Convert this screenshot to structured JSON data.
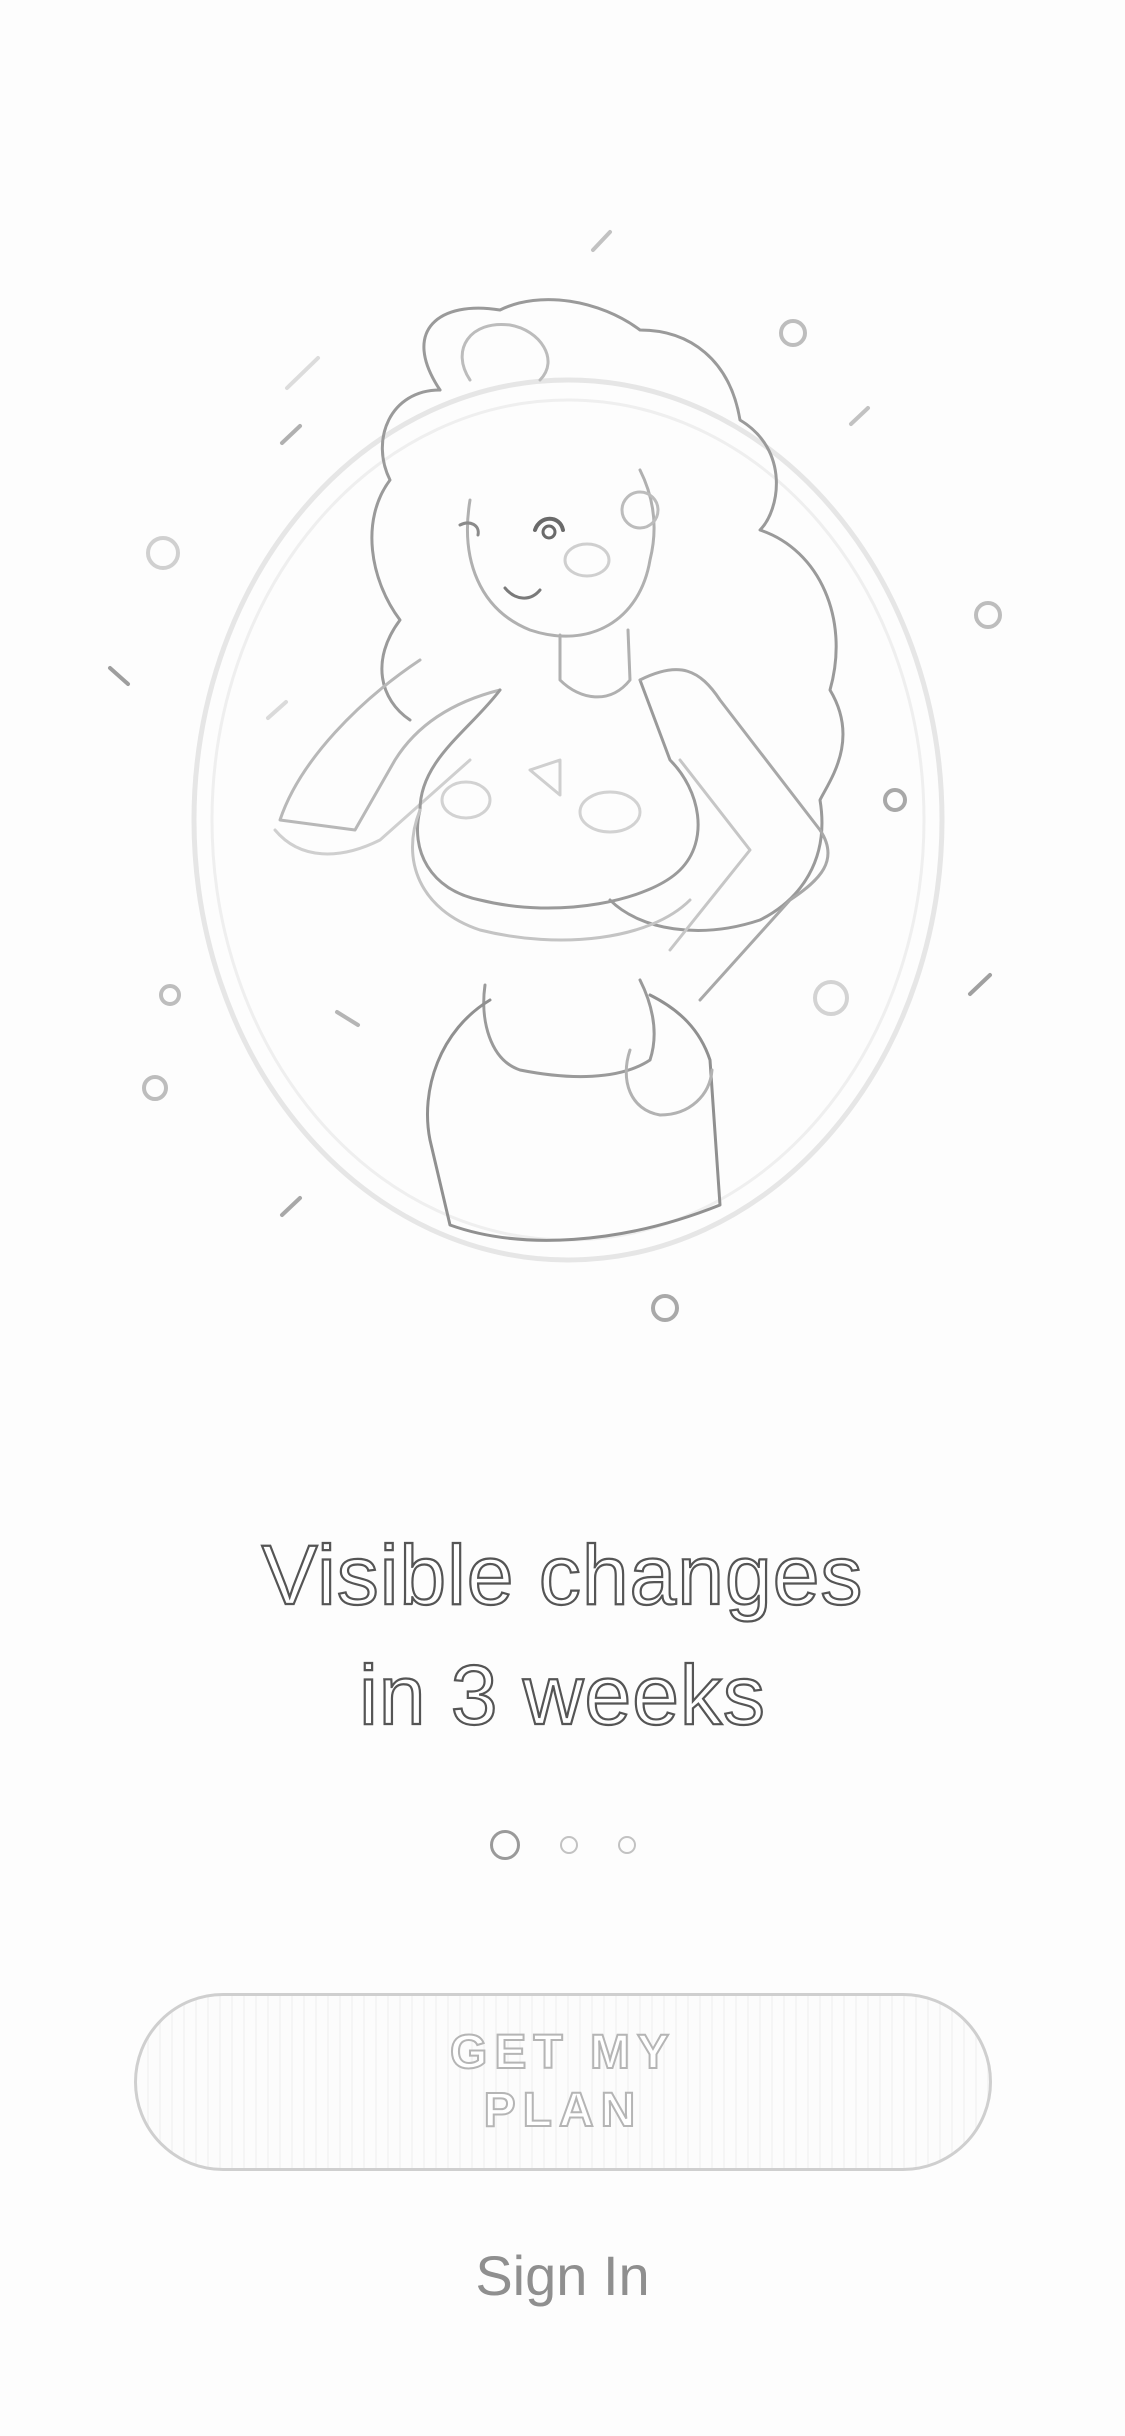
{
  "onboarding": {
    "illustration": "woman-posing-illustration",
    "headline_line1": "Visible changes",
    "headline_line2": "in 3 weeks",
    "pagination": {
      "pages": 3,
      "active_index": 0
    },
    "primary_button_label": "GET MY PLAN",
    "secondary_link_label": "Sign In"
  },
  "colors": {
    "background": "#fdfdfd",
    "headline_stroke": "#555555",
    "button_border": "#cfcfcf",
    "sign_in_text": "#8f8f8f"
  }
}
